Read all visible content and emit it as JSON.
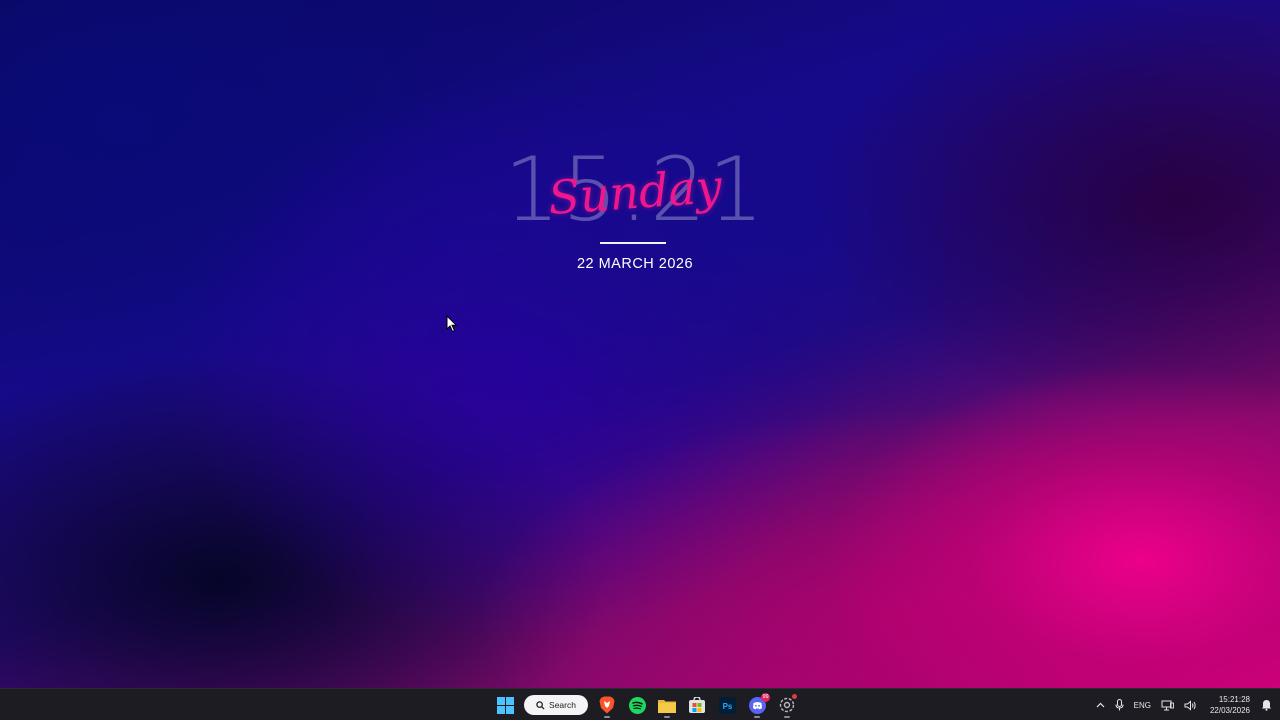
{
  "desktop": {
    "clock": {
      "time": "15.21",
      "day": "Sunday",
      "date": "22 MARCH 2026"
    }
  },
  "taskbar": {
    "search_label": "Search",
    "apps": [
      {
        "name": "Brave",
        "icon": "brave-icon",
        "color": "#fb542b"
      },
      {
        "name": "Spotify",
        "icon": "spotify-icon",
        "color": "#1ed760"
      },
      {
        "name": "File Explorer",
        "icon": "folder-icon",
        "color": "#f7c948"
      },
      {
        "name": "Microsoft Store",
        "icon": "store-icon",
        "color": "#dfe3ea"
      },
      {
        "name": "Photoshop",
        "icon": "photoshop-icon",
        "color": "#31a8ff"
      },
      {
        "name": "Discord",
        "icon": "discord-icon",
        "color": "#5865f2",
        "badge": "99"
      },
      {
        "name": "Settings",
        "icon": "settings-icon",
        "color": "#b8b8c4"
      }
    ],
    "tray": {
      "language": "ENG",
      "time": "15:21:28",
      "date": "22/03/2026"
    }
  },
  "colors": {
    "accent": "#f0178c",
    "taskbar_bg": "#1c1c22"
  }
}
